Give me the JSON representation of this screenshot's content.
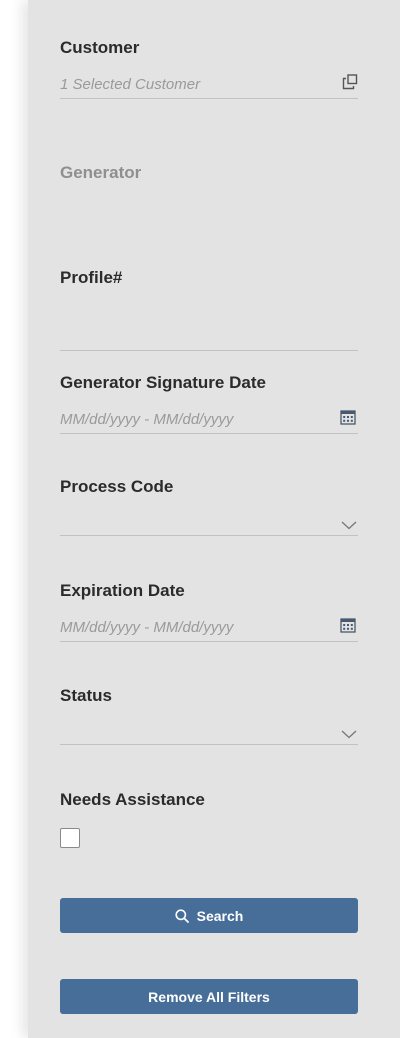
{
  "filters": {
    "customer": {
      "label": "Customer",
      "placeholder": "1 Selected Customer",
      "icon": "copy-icon"
    },
    "generator": {
      "label": "Generator"
    },
    "profile": {
      "label": "Profile#",
      "value": ""
    },
    "generator_signature_date": {
      "label": "Generator Signature Date",
      "placeholder": "MM/dd/yyyy - MM/dd/yyyy",
      "icon": "calendar-icon"
    },
    "process_code": {
      "label": "Process Code",
      "selected": "",
      "icon": "chevron-down-icon"
    },
    "expiration_date": {
      "label": "Expiration Date",
      "placeholder": "MM/dd/yyyy - MM/dd/yyyy",
      "icon": "calendar-icon"
    },
    "status": {
      "label": "Status",
      "selected": "",
      "icon": "chevron-down-icon"
    },
    "needs_assistance": {
      "label": "Needs Assistance",
      "checked": false
    }
  },
  "actions": {
    "search_label": "Search",
    "remove_filters_label": "Remove All Filters"
  },
  "colors": {
    "panel_background": "#e3e3e3",
    "button_primary": "#466e98",
    "label_text": "#2b2b2b",
    "disabled_text": "#8f8f8f",
    "placeholder_text": "#9a9a9a",
    "underline": "#c2c2c2"
  }
}
